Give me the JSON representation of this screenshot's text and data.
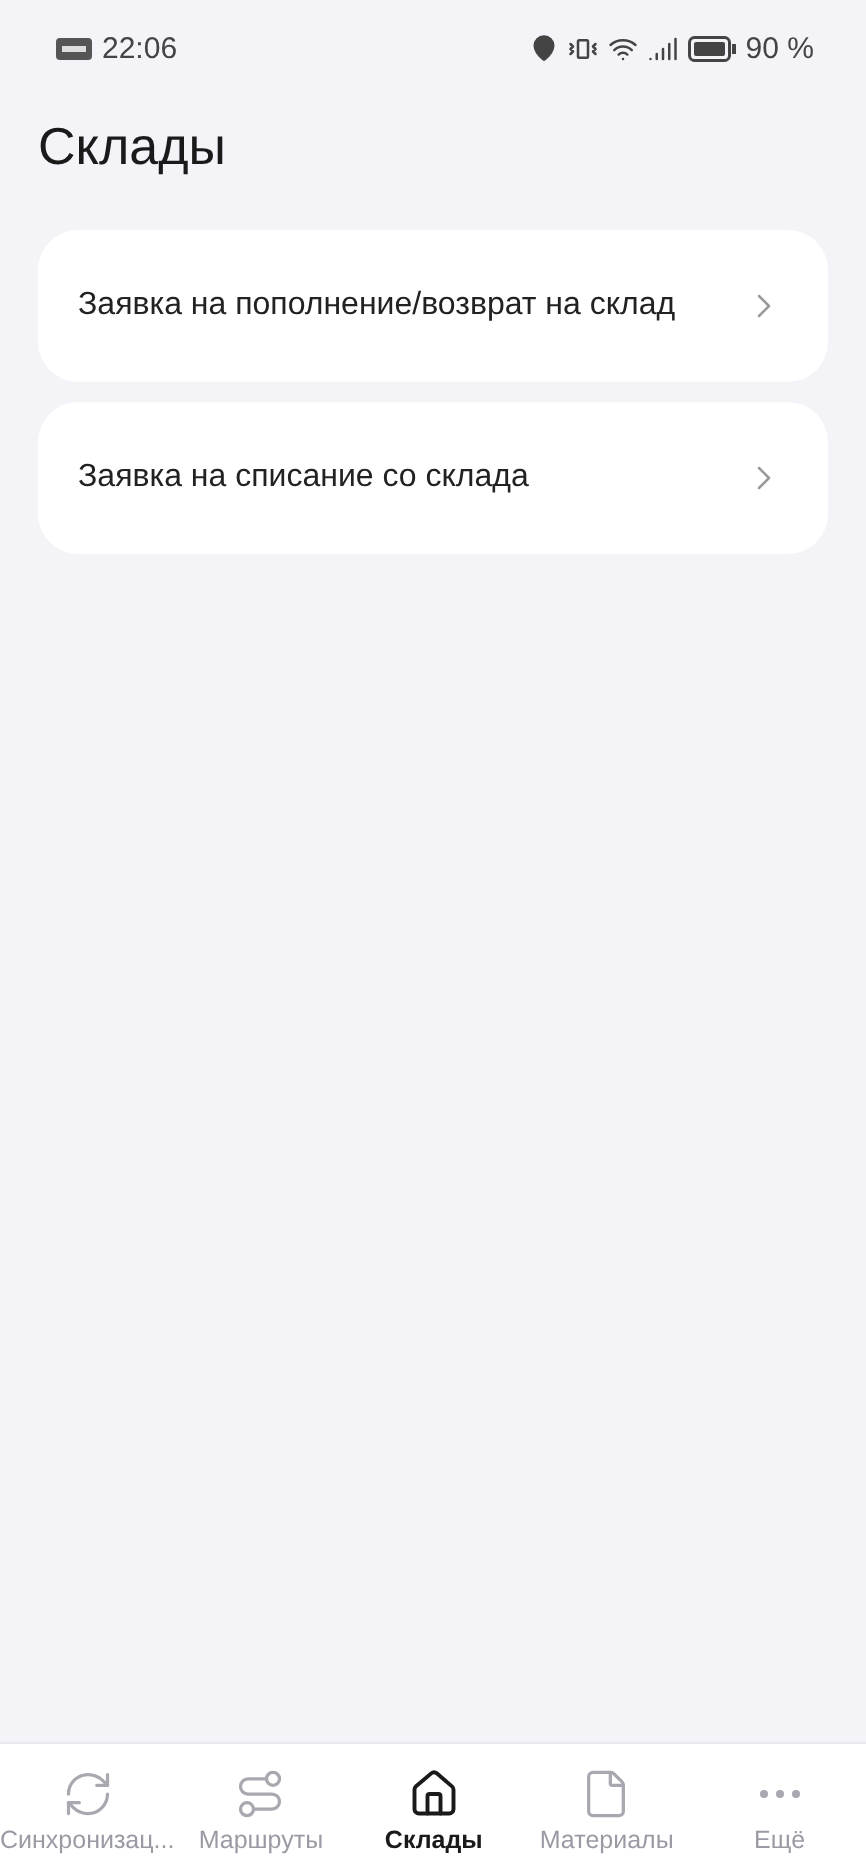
{
  "status_bar": {
    "time": "22:06",
    "battery": "90 %"
  },
  "title": "Склады",
  "items": [
    {
      "label": "Заявка на пополнение/возврат на склад"
    },
    {
      "label": "Заявка на списание со склада"
    }
  ],
  "tabs": [
    {
      "label": "Синхронизац...",
      "selected": false
    },
    {
      "label": "Маршруты",
      "selected": false
    },
    {
      "label": "Склады",
      "selected": true
    },
    {
      "label": "Материалы",
      "selected": false
    },
    {
      "label": "Ещё",
      "selected": false
    }
  ]
}
